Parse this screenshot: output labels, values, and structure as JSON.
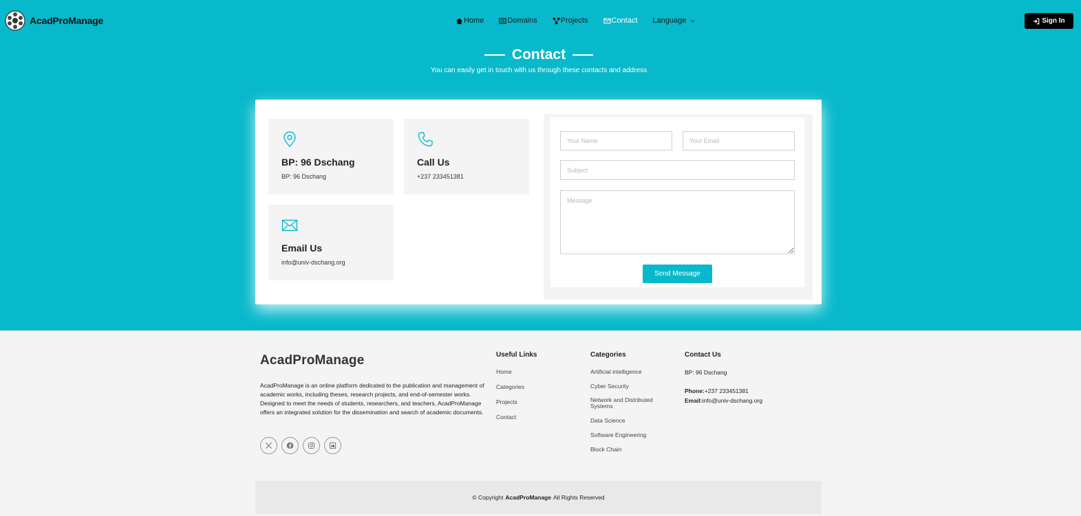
{
  "header": {
    "brand": "AcadProManage",
    "nav": [
      {
        "label": "Home",
        "icon": "home-icon"
      },
      {
        "label": "Domains",
        "icon": "list-icon"
      },
      {
        "label": "Projects",
        "icon": "project-icon"
      },
      {
        "label": "Contact",
        "icon": "envelope-icon"
      },
      {
        "label": "Language",
        "icon": "chevron-down-icon"
      }
    ],
    "active_nav": "Contact",
    "sign_in": "Sign In"
  },
  "section": {
    "title": "Contact",
    "subtitle": "You can easily get in touch with us through these contacts and address"
  },
  "contact_info": {
    "address": {
      "title": "BP: 96 Dschang",
      "text": "BP: 96 Dschang",
      "icon": "location-pin-icon"
    },
    "call": {
      "title": "Call Us",
      "text": "+237 233451381",
      "icon": "phone-icon"
    },
    "email": {
      "title": "Email Us",
      "text": "info@univ-dschang.org",
      "icon": "envelope-icon"
    }
  },
  "form": {
    "name_placeholder": "Your Name",
    "email_placeholder": "Your Email",
    "subject_placeholder": "Subject",
    "message_placeholder": "Message",
    "submit": "Send Message"
  },
  "footer": {
    "brand": "AcadProManage",
    "description": "AcadProManage is an online platform dedicated to the publication and management of academic works, including theses, research projects, and end-of-semester works. Designed to meet the needs of students, researchers, and teachers, AcadProManage offers an integrated solution for the dissemination and search of academic documents.",
    "socials": [
      "x-icon",
      "facebook-icon",
      "instagram-icon",
      "linkedin-icon"
    ],
    "useful_links": {
      "title": "Useful Links",
      "items": [
        "Home",
        "Categories",
        "Projects",
        "Contact"
      ]
    },
    "categories": {
      "title": "Categories",
      "items": [
        "Artificial intelligence",
        "Cyber Security",
        "Network and Distributed Systems",
        "Data Science",
        "Software Engineering",
        "Block Chain"
      ]
    },
    "contact": {
      "title": "Contact Us",
      "address": "BP: 96 Dschang",
      "phone_label": "Phone:",
      "phone": "+237 233451381",
      "email_label": "Email:",
      "email": "info@univ-dschang.org"
    },
    "copyright_prefix": "© Copyright",
    "copyright_brand": "AcadProManage",
    "copyright_suffix": "All Rights Reserved"
  },
  "colors": {
    "primary": "#08b9cb",
    "background": "#f4f4f5",
    "sign_in": "#000000"
  }
}
